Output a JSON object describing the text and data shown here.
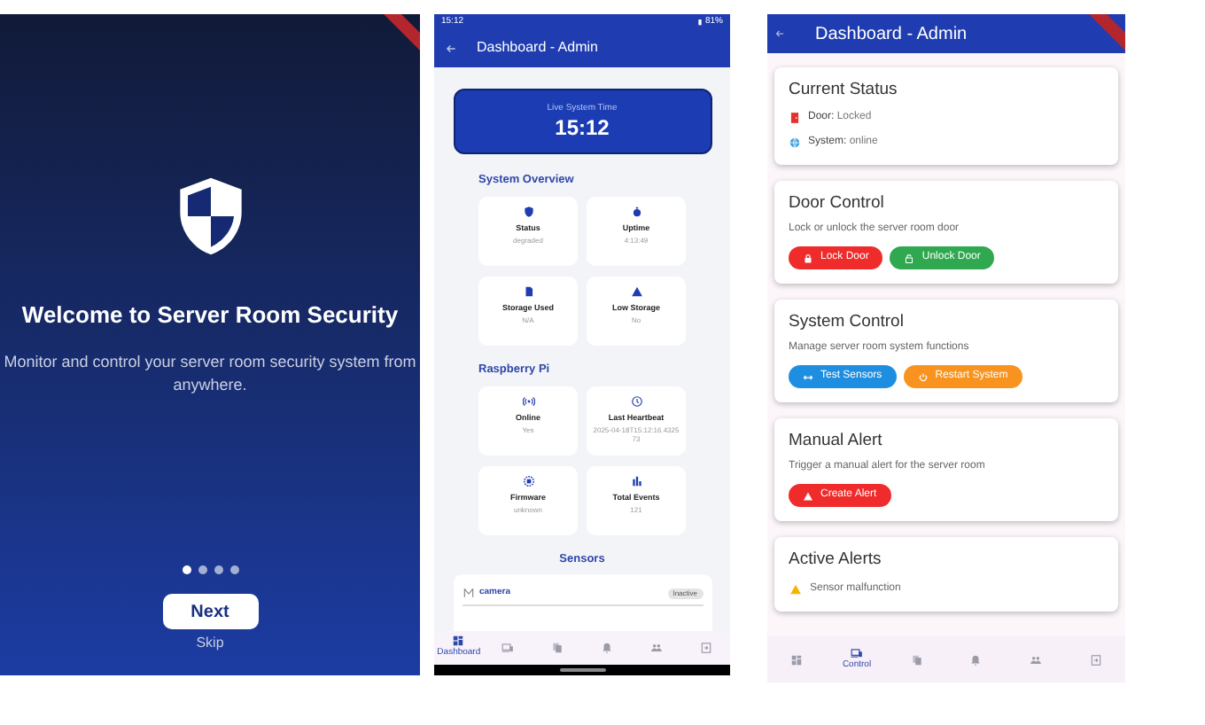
{
  "onboarding": {
    "title": "Welcome to Server Room Security",
    "description": "Monitor and control your server room security system from anywhere.",
    "pages": [
      {
        "selected": true
      },
      {
        "selected": false
      },
      {
        "selected": false
      },
      {
        "selected": false
      }
    ],
    "next_button": "Next",
    "skip_link": "Skip"
  },
  "dashboard": {
    "status_bar": {
      "time": "15:12",
      "battery": "81%"
    },
    "title": "Dashboard - Admin",
    "time_card": {
      "label": "Live System Time",
      "value": "15:12"
    },
    "sections": [
      {
        "heading": "System Overview",
        "tiles": [
          {
            "label": "Status",
            "value": "degraded"
          },
          {
            "label": "Uptime",
            "value": "4:13:49"
          },
          {
            "label": "Storage Used",
            "value": "N/A"
          },
          {
            "label": "Low Storage",
            "value": "No"
          }
        ]
      },
      {
        "heading": "Raspberry Pi",
        "tiles": [
          {
            "label": "Online",
            "value": "Yes"
          },
          {
            "label": "Last Heartbeat",
            "value": "2025-04-18T15:12:16.432573"
          },
          {
            "label": "Firmware",
            "value": "unknown"
          },
          {
            "label": "Total Events",
            "value": "121"
          }
        ]
      }
    ],
    "sensors": {
      "heading": "Sensors",
      "items": [
        {
          "name": "camera",
          "status": "Inactive"
        }
      ]
    },
    "nav": [
      {
        "label": "Dashboard",
        "selected": true
      },
      {
        "selected": false
      },
      {
        "selected": false
      },
      {
        "selected": false
      },
      {
        "selected": false
      },
      {
        "selected": false
      }
    ]
  },
  "control": {
    "title": "Dashboard - Admin",
    "cards": [
      {
        "kind": "status",
        "title": "Current Status",
        "rows": [
          {
            "label": "Door:",
            "value": "Locked"
          },
          {
            "label": "System:",
            "value": "online"
          }
        ]
      },
      {
        "kind": "actions",
        "title": "Door Control",
        "description": "Lock or unlock the server room door",
        "buttons": [
          {
            "label": "Lock Door",
            "color": "#ef2b2b"
          },
          {
            "label": "Unlock Door",
            "color": "#2fa84f"
          }
        ]
      },
      {
        "kind": "actions",
        "title": "System Control",
        "description": "Manage server room system functions",
        "buttons": [
          {
            "label": "Test Sensors",
            "color": "#1e8fe0"
          },
          {
            "label": "Restart System",
            "color": "#f7931e"
          }
        ]
      },
      {
        "kind": "actions",
        "title": "Manual Alert",
        "description": "Trigger a manual alert for the server room",
        "buttons": [
          {
            "label": "Create Alert",
            "color": "#ef2b2b"
          }
        ]
      },
      {
        "kind": "alerts",
        "title": "Active Alerts",
        "items": [
          {
            "text": "Sensor malfunction"
          }
        ]
      }
    ],
    "nav": [
      {
        "selected": false
      },
      {
        "label": "Control",
        "selected": true
      },
      {
        "selected": false
      },
      {
        "selected": false
      },
      {
        "selected": false
      },
      {
        "selected": false
      }
    ]
  }
}
